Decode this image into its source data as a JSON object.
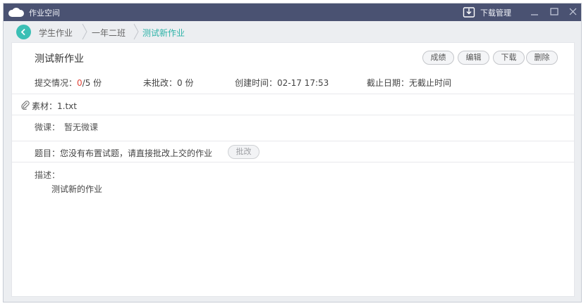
{
  "titlebar": {
    "app_title": "作业空间",
    "download_manager": "下载管理"
  },
  "breadcrumb": {
    "items": [
      "学生作业",
      "一年二班",
      "测试新作业"
    ]
  },
  "homework": {
    "title": "测试新作业",
    "actions": {
      "score": "成绩",
      "edit": "编辑",
      "download": "下载",
      "delete": "删除"
    },
    "submission_label": "提交情况：",
    "submission_count": "0",
    "submission_total": "/5 份",
    "uncorrected": "未批改：0 份",
    "created": "创建时间：02-17 17:53",
    "deadline": "截止日期：无截止时间",
    "material": "素材：1.txt",
    "microlesson_label": "微课：",
    "microlesson_value": "暂无微课",
    "question": "题目：您没有布置试题，请直接批改上交的作业",
    "correct_button": "批改",
    "description_label": "描述：",
    "description_text": "测试新的作业"
  },
  "colors": {
    "titlebar": "#4a5272",
    "accent": "#3bbfb5",
    "count_highlight": "#e0453a"
  }
}
